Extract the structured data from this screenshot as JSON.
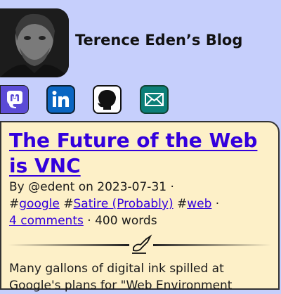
{
  "site": {
    "title": "Terence Eden’s Blog"
  },
  "social_links": [
    {
      "name": "mastodon",
      "icon": "mastodon-icon",
      "color": "#5b4bd6"
    },
    {
      "name": "linkedin",
      "icon": "linkedin-icon",
      "color": "#0a66c2"
    },
    {
      "name": "github",
      "icon": "github-icon",
      "color": "#111111"
    },
    {
      "name": "email",
      "icon": "email-icon",
      "color": "#0c7f78"
    }
  ],
  "post": {
    "title": "The Future of the Web is VNC",
    "by_prefix": "By ",
    "author": "@edent",
    "on_word": " on ",
    "date": "2023-07-31",
    "separator": " ·",
    "tags": [
      {
        "hash": "#",
        "label": "google"
      },
      {
        "hash": "#",
        "label": "Satire (Probably)"
      },
      {
        "hash": "#",
        "label": "web"
      }
    ],
    "comments": "4 comments",
    "dot": " · ",
    "word_count": "400 words",
    "excerpt_line1": "Many gallons of digital ink spilled at",
    "excerpt_line2": "Google's plans for \"Web Environment"
  },
  "colors": {
    "background": "#c6cffc",
    "article_background": "#fdf0c8",
    "link": "#3300dd"
  }
}
